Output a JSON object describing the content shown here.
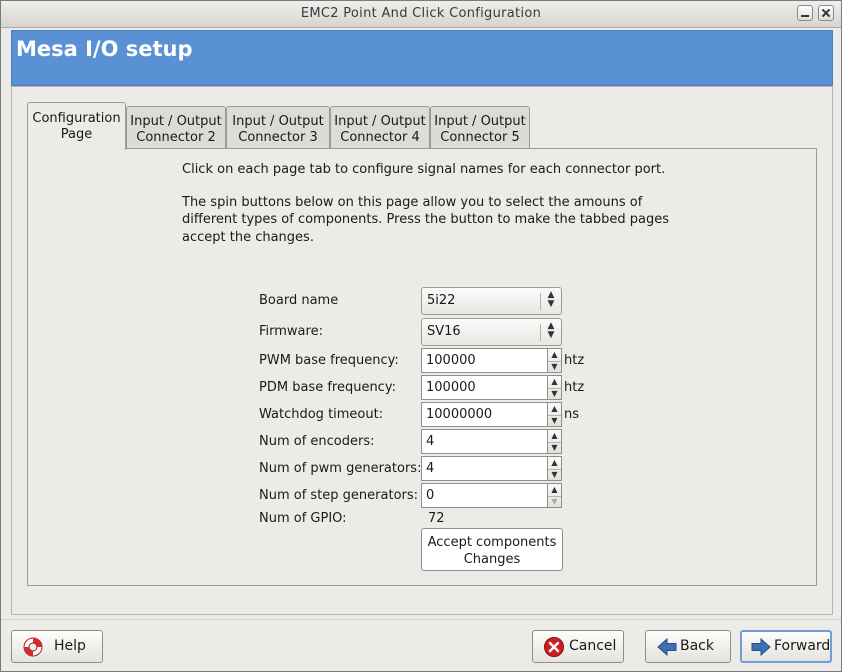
{
  "window": {
    "title": "EMC2 Point And Click Configuration"
  },
  "banner": {
    "title": "Mesa I/O setup"
  },
  "tabs": [
    {
      "line1": "Configuration",
      "line2": "Page"
    },
    {
      "line1": "Input / Output",
      "line2": "Connector 2"
    },
    {
      "line1": "Input / Output",
      "line2": "Connector 3"
    },
    {
      "line1": "Input / Output",
      "line2": "Connector 4"
    },
    {
      "line1": "Input / Output",
      "line2": "Connector 5"
    }
  ],
  "info": {
    "line1": "Click on each page tab to configure signal names for each connector port.",
    "line2": "The spin buttons below on this page allow you to select the amouns of",
    "line3": "different types of components. Press the button to make the tabbed pages",
    "line4": "accept the changes."
  },
  "form": {
    "board_name_label": "Board name",
    "board_name_value": "5i22",
    "firmware_label": "Firmware:",
    "firmware_value": "SV16",
    "pwm_freq_label": "PWM base frequency:",
    "pwm_freq_value": "100000",
    "pwm_freq_unit": "htz",
    "pdm_freq_label": "PDM base frequency:",
    "pdm_freq_value": "100000",
    "pdm_freq_unit": "htz",
    "watchdog_label": "Watchdog timeout:",
    "watchdog_value": "10000000",
    "watchdog_unit": "ns",
    "encoders_label": "Num of encoders:",
    "encoders_value": "4",
    "pwmgen_label": "Num of pwm generators:",
    "pwmgen_value": "4",
    "stepgen_label": "Num of step generators:",
    "stepgen_value": "0",
    "gpio_label": "Num of GPIO:",
    "gpio_value": "72",
    "accept_line1": "Accept  components",
    "accept_line2": "Changes"
  },
  "buttons": {
    "help": "Help",
    "cancel": "Cancel",
    "back": "Back",
    "forward": "Forward"
  },
  "icons": {
    "help": "lifebuoy-icon",
    "cancel": "cancel-icon",
    "back": "arrow-left-icon",
    "forward": "arrow-right-icon"
  },
  "colors": {
    "banner": "#5a91d4",
    "window_bg": "#ecebe7"
  }
}
